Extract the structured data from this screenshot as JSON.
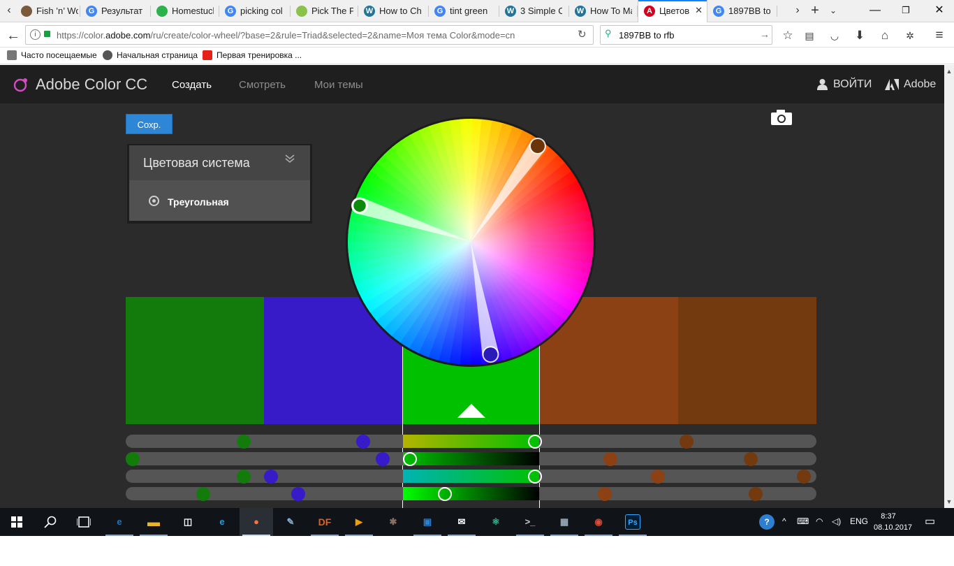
{
  "browser": {
    "tabs": [
      {
        "label": "Fish ’n’ Wo",
        "favicon": "image-thumbnail-icon",
        "color": "#7a5a3a"
      },
      {
        "label": "Результат",
        "favicon": "google-icon",
        "color": "#4285f4"
      },
      {
        "label": "Homestuck",
        "favicon": "homestuck-icon",
        "color": "#2bb24c"
      },
      {
        "label": "picking col",
        "favicon": "google-icon",
        "color": "#4285f4"
      },
      {
        "label": "Pick The Pe",
        "favicon": "leaf-icon",
        "color": "#8bc34a"
      },
      {
        "label": "How to Ch",
        "favicon": "wordpress-icon",
        "color": "#21759b"
      },
      {
        "label": "tint green",
        "favicon": "google-icon",
        "color": "#4285f4"
      },
      {
        "label": "3 Simple Cr",
        "favicon": "wordpress-icon",
        "color": "#21759b"
      },
      {
        "label": "How To Ma",
        "favicon": "wordpress-icon",
        "color": "#21759b"
      },
      {
        "label": "Цветов",
        "favicon": "adobe-icon",
        "color": "#d4001e",
        "active": true
      },
      {
        "label": "1897BB to",
        "favicon": "google-icon",
        "color": "#4285f4"
      }
    ],
    "url_prefix": "https://color.",
    "url_domain": "adobe.com",
    "url_rest": "/ru/create/color-wheel/?base=2&rule=Triad&selected=2&name=Моя тема Color&mode=cn",
    "search_value": "1897BB to rfb",
    "bookmarks": [
      {
        "label": "Часто посещаемые",
        "icon": "gear-icon"
      },
      {
        "label": "Начальная страница",
        "icon": "firefox-icon"
      },
      {
        "label": "Первая тренировка ...",
        "icon": "youtube-icon"
      }
    ]
  },
  "app": {
    "logo": "Adobe Color CC",
    "nav": [
      {
        "label": "Создать",
        "active": true
      },
      {
        "label": "Смотреть",
        "active": false
      },
      {
        "label": "Мои темы",
        "active": false
      }
    ],
    "signin": "ВОЙТИ",
    "adobe": "Adobe",
    "save_label": "Сохр.",
    "rule_title": "Цветовая система",
    "rule_value": "Треугольная"
  },
  "palette": {
    "swatches": [
      "#137B0B",
      "#371BC8",
      "#00C000",
      "#8B4113",
      "#733A0F"
    ],
    "selected_index": 2,
    "wheel_handles": [
      {
        "angle_deg": 35,
        "radius_frac": 0.95,
        "color": "#6a3509"
      },
      {
        "angle_deg": 288,
        "radius_frac": 0.95,
        "color": "#0c8a0c",
        "selected": true
      },
      {
        "angle_deg": 170,
        "radius_frac": 0.93,
        "color": "#2a1ab8"
      }
    ],
    "sliders": [
      {
        "gradient": [
          "#b4b400",
          "#00c000"
        ],
        "dots": [
          0.171,
          0.344,
          0.593,
          0.812
        ]
      },
      {
        "gradient": [
          "#00c000",
          "#000000"
        ],
        "dots": [
          0.01,
          0.372,
          0.412,
          0.702,
          0.905
        ]
      },
      {
        "gradient": [
          "#00b4b4",
          "#00c000"
        ],
        "dots": [
          0.171,
          0.21,
          0.593,
          0.77,
          0.982
        ]
      },
      {
        "gradient": [
          "#00ff00",
          "#000000"
        ],
        "dots": [
          0.112,
          0.25,
          0.462,
          0.694,
          0.912
        ]
      }
    ],
    "slider_selected_dot": [
      0.593,
      0.412,
      0.593,
      0.462
    ],
    "slider_colors": [
      "#137B0B",
      "#371BC8",
      "#00C000",
      "#8B4113",
      "#733A0F"
    ]
  },
  "taskbar": {
    "lang": "ENG",
    "time": "8:37",
    "date": "08.10.2017",
    "apps": [
      {
        "name": "edge-icon",
        "color": "#1a78c2",
        "glyph": "e"
      },
      {
        "name": "folder-icon",
        "color": "#e9b52f",
        "glyph": "▬"
      },
      {
        "name": "store-icon",
        "color": "#ffffff",
        "glyph": "◫"
      },
      {
        "name": "ie-icon",
        "color": "#1ea0e6",
        "glyph": "e"
      },
      {
        "name": "firefox-icon",
        "color": "#ff7139",
        "glyph": "●"
      },
      {
        "name": "paint-icon",
        "color": "#7fb0d8",
        "glyph": "✎"
      },
      {
        "name": "df-icon",
        "color": "#e06020",
        "glyph": "DF"
      },
      {
        "name": "media-player-icon",
        "color": "#f0a000",
        "glyph": "▶"
      },
      {
        "name": "gimp-icon",
        "color": "#8a7060",
        "glyph": "✱"
      },
      {
        "name": "notes-icon",
        "color": "#2f7fd0",
        "glyph": "▣"
      },
      {
        "name": "mail-icon",
        "color": "#ffffff",
        "glyph": "✉"
      },
      {
        "name": "atom-icon",
        "color": "#3cba92",
        "glyph": "⚛"
      },
      {
        "name": "terminal-icon",
        "color": "#cccccc",
        "glyph": ">_"
      },
      {
        "name": "photos-icon",
        "color": "#9ab",
        "glyph": "▦"
      },
      {
        "name": "chrome-icon",
        "color": "#dd4b39",
        "glyph": "◉"
      },
      {
        "name": "photoshop-icon",
        "color": "#31a8ff",
        "glyph": "Ps"
      }
    ]
  }
}
